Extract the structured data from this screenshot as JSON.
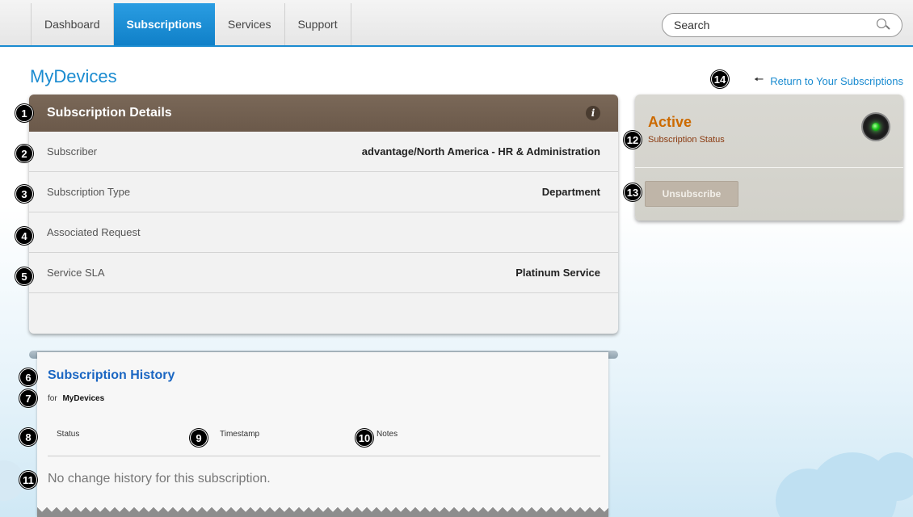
{
  "nav": {
    "tabs": [
      {
        "label": "Dashboard"
      },
      {
        "label": "Subscriptions"
      },
      {
        "label": "Services"
      },
      {
        "label": "Support"
      }
    ],
    "active_tab": "Subscriptions",
    "search_placeholder": "Search"
  },
  "page": {
    "title": "MyDevices",
    "return_link": "Return to Your Subscriptions"
  },
  "details": {
    "header": "Subscription Details",
    "rows": [
      {
        "label": "Subscriber",
        "value": "advantage/North America - HR & Administration"
      },
      {
        "label": "Subscription Type",
        "value": "Department"
      },
      {
        "label": "Associated Request",
        "value": ""
      },
      {
        "label": "Service SLA",
        "value": "Platinum Service"
      }
    ]
  },
  "history": {
    "title": "Subscription History",
    "for_label": "for",
    "for_value": "MyDevices",
    "columns": [
      "Status",
      "Timestamp",
      "Notes"
    ],
    "empty_message": "No change history for this subscription."
  },
  "status": {
    "title": "Active",
    "subtitle": "Subscription Status",
    "unsubscribe_label": "Unsubscribe"
  },
  "badges": [
    "1",
    "2",
    "3",
    "4",
    "5",
    "6",
    "7",
    "8",
    "9",
    "10",
    "11",
    "12",
    "13",
    "14"
  ],
  "colors": {
    "accent": "#1a8bd0",
    "header_brown": "#6b594a",
    "status_orange": "#cc6a00",
    "history_title": "#1a66c2"
  }
}
